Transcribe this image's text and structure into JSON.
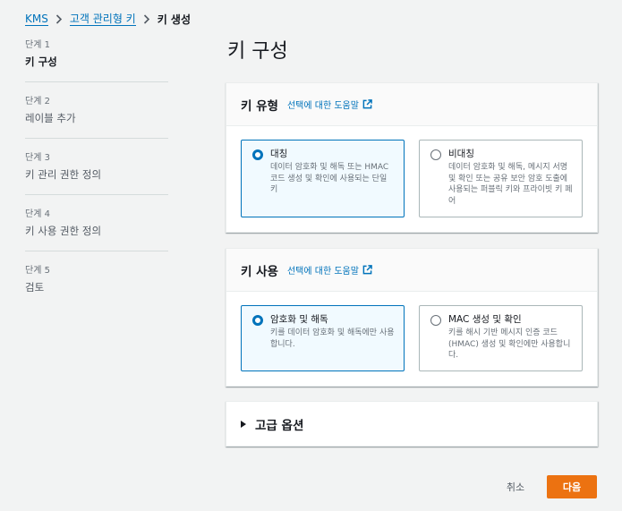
{
  "breadcrumb": {
    "items": [
      "KMS",
      "고객 관리형 키"
    ],
    "current": "키 생성"
  },
  "steps": [
    {
      "num": "단계 1",
      "label": "키 구성",
      "active": true
    },
    {
      "num": "단계 2",
      "label": "레이블 추가"
    },
    {
      "num": "단계 3",
      "label": "키 관리 권한 정의"
    },
    {
      "num": "단계 4",
      "label": "키 사용 권한 정의"
    },
    {
      "num": "단계 5",
      "label": "검토"
    }
  ],
  "page": {
    "title": "키 구성"
  },
  "key_type": {
    "title": "키 유형",
    "info_link": "선택에 대한 도움말",
    "options": [
      {
        "title": "대칭",
        "desc": "데이터 암호화 및 해독 또는 HMAC 코드 생성 및 확인에 사용되는 단일 키",
        "selected": true
      },
      {
        "title": "비대칭",
        "desc": "데이터 암호화 및 해독, 메시지 서명 및 확인 또는 공유 보안 암호 도출에 사용되는 퍼블릭 키와 프라이빗 키 페어",
        "selected": false
      }
    ]
  },
  "key_usage": {
    "title": "키 사용",
    "info_link": "선택에 대한 도움말",
    "options": [
      {
        "title": "암호화 및 해독",
        "desc": "키를 데이터 암호화 및 해독에만 사용합니다.",
        "selected": true
      },
      {
        "title": "MAC 생성 및 확인",
        "desc": "키를 해시 기반 메시지 인증 코드(HMAC) 생성 및 확인에만 사용합니다.",
        "selected": false
      }
    ]
  },
  "advanced": {
    "title": "고급 옵션"
  },
  "actions": {
    "cancel": "취소",
    "next": "다음"
  },
  "colors": {
    "link": "#0073bb",
    "primary_button": "#ec7211",
    "selected_border": "#0073bb",
    "selected_bg": "#f1faff"
  }
}
